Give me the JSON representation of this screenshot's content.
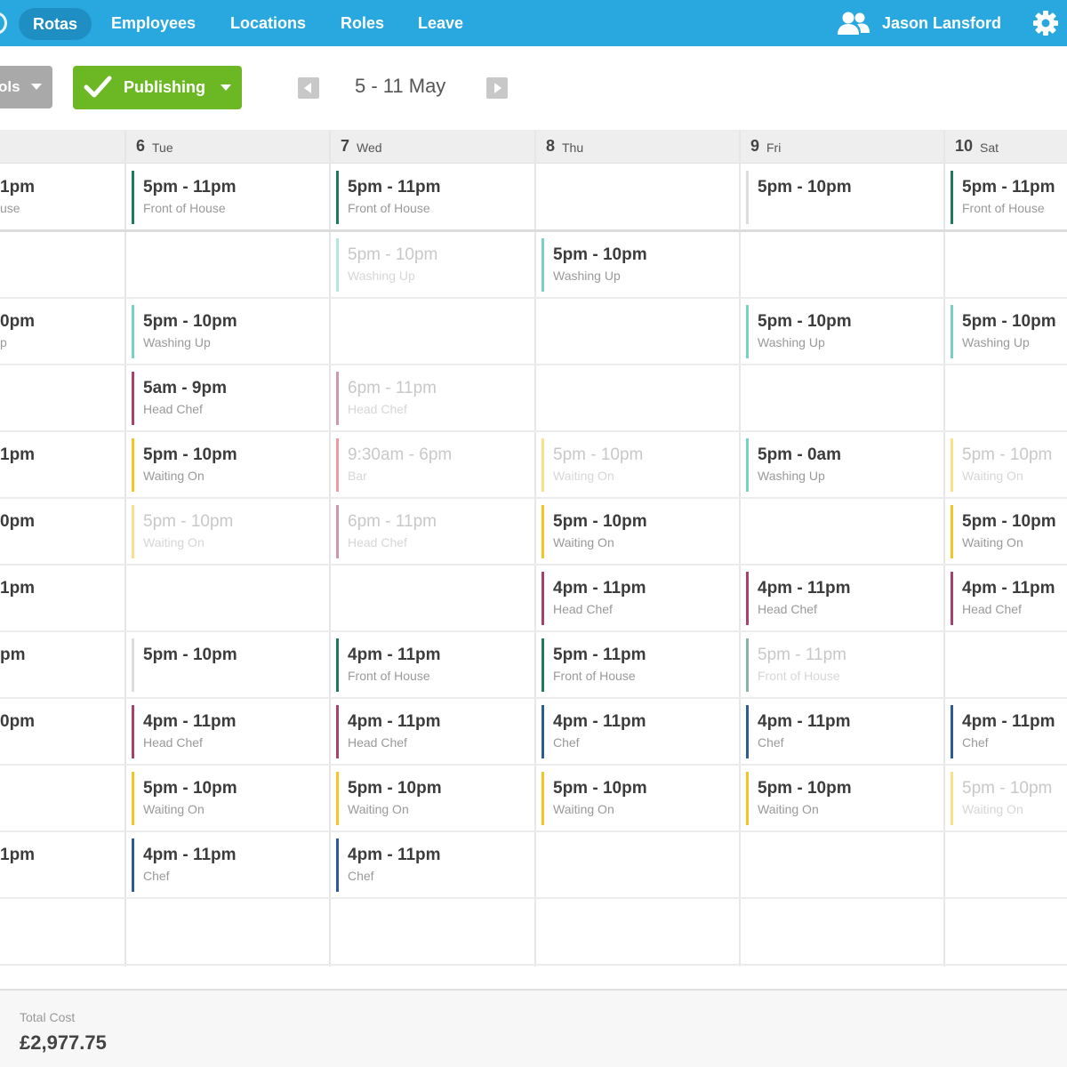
{
  "nav": {
    "items": [
      "Rotas",
      "Employees",
      "Locations",
      "Roles",
      "Leave"
    ],
    "user_name": "Jason Lansford"
  },
  "toolbar": {
    "tools_label": "ols",
    "publish_label": "Publishing",
    "date_range": "5 - 11 May"
  },
  "days": [
    {
      "num": "6",
      "name": "Tue"
    },
    {
      "num": "7",
      "name": "Wed"
    },
    {
      "num": "8",
      "name": "Thu"
    },
    {
      "num": "9",
      "name": "Fri"
    },
    {
      "num": "10",
      "name": "Sat"
    }
  ],
  "colors": {
    "front_of_house": "#1e7a5f",
    "washing_up": "#78d2c3",
    "head_chef": "#a8416b",
    "waiting_on": "#f5c623",
    "bar": "#e3455a",
    "chef": "#2c5c94",
    "unassigned": "#dcdcdc"
  },
  "rows": [
    {
      "partial": {
        "time": "1pm",
        "role": "use"
      },
      "cells": [
        {
          "time": "5pm - 11pm",
          "role": "Front of House",
          "color": "front_of_house"
        },
        {
          "time": "5pm - 11pm",
          "role": "Front of House",
          "color": "front_of_house"
        },
        null,
        {
          "time": "5pm - 10pm",
          "role": "",
          "color": "unassigned"
        },
        {
          "time": "5pm - 11pm",
          "role": "Front of House",
          "color": "front_of_house"
        }
      ]
    },
    {
      "partial": null,
      "cells": [
        null,
        {
          "time": "5pm - 10pm",
          "role": "Washing Up",
          "color": "washing_up",
          "faded": true
        },
        {
          "time": "5pm - 10pm",
          "role": "Washing Up",
          "color": "washing_up"
        },
        null,
        null
      ]
    },
    {
      "partial": {
        "time": "0pm",
        "role": "p"
      },
      "cells": [
        {
          "time": "5pm - 10pm",
          "role": "Washing Up",
          "color": "washing_up"
        },
        null,
        null,
        {
          "time": "5pm - 10pm",
          "role": "Washing Up",
          "color": "washing_up"
        },
        {
          "time": "5pm - 10pm",
          "role": "Washing Up",
          "color": "washing_up"
        }
      ]
    },
    {
      "partial": null,
      "cells": [
        {
          "time": "5am - 9pm",
          "role": "Head Chef",
          "color": "head_chef"
        },
        {
          "time": "6pm - 11pm",
          "role": "Head Chef",
          "color": "head_chef",
          "faded": true
        },
        null,
        null,
        null
      ]
    },
    {
      "partial": {
        "time": "1pm",
        "role": ""
      },
      "cells": [
        {
          "time": "5pm - 10pm",
          "role": "Waiting On",
          "color": "waiting_on"
        },
        {
          "time": "9:30am - 6pm",
          "role": "Bar",
          "color": "bar",
          "faded": true
        },
        {
          "time": "5pm - 10pm",
          "role": "Waiting On",
          "color": "waiting_on",
          "faded": true
        },
        {
          "time": "5pm - 0am",
          "role": "Washing Up",
          "color": "washing_up"
        },
        {
          "time": "5pm - 10pm",
          "role": "Waiting On",
          "color": "waiting_on",
          "faded": true
        }
      ]
    },
    {
      "partial": {
        "time": "0pm",
        "role": ""
      },
      "cells": [
        {
          "time": "5pm - 10pm",
          "role": "Waiting On",
          "color": "waiting_on",
          "faded": true
        },
        {
          "time": "6pm - 11pm",
          "role": "Head Chef",
          "color": "head_chef",
          "faded": true
        },
        {
          "time": "5pm - 10pm",
          "role": "Waiting On",
          "color": "waiting_on"
        },
        null,
        {
          "time": "5pm - 10pm",
          "role": "Waiting On",
          "color": "waiting_on"
        }
      ]
    },
    {
      "partial": {
        "time": "1pm",
        "role": ""
      },
      "cells": [
        null,
        null,
        {
          "time": "4pm - 11pm",
          "role": "Head Chef",
          "color": "head_chef"
        },
        {
          "time": "4pm - 11pm",
          "role": "Head Chef",
          "color": "head_chef"
        },
        {
          "time": "4pm - 11pm",
          "role": "Head Chef",
          "color": "head_chef"
        }
      ]
    },
    {
      "partial": {
        "time": "pm",
        "role": ""
      },
      "cells": [
        {
          "time": "5pm - 10pm",
          "role": "",
          "color": "unassigned"
        },
        {
          "time": "4pm - 11pm",
          "role": "Front of House",
          "color": "front_of_house"
        },
        {
          "time": "5pm - 11pm",
          "role": "Front of House",
          "color": "front_of_house"
        },
        {
          "time": "5pm - 11pm",
          "role": "Front of House",
          "color": "front_of_house",
          "faded": true
        },
        null
      ]
    },
    {
      "partial": {
        "time": "0pm",
        "role": ""
      },
      "cells": [
        {
          "time": "4pm - 11pm",
          "role": "Head Chef",
          "color": "head_chef"
        },
        {
          "time": "4pm - 11pm",
          "role": "Head Chef",
          "color": "head_chef"
        },
        {
          "time": "4pm - 11pm",
          "role": "Chef",
          "color": "chef"
        },
        {
          "time": "4pm - 11pm",
          "role": "Chef",
          "color": "chef"
        },
        {
          "time": "4pm - 11pm",
          "role": "Chef",
          "color": "chef"
        }
      ]
    },
    {
      "partial": null,
      "cells": [
        {
          "time": "5pm - 10pm",
          "role": "Waiting On",
          "color": "waiting_on"
        },
        {
          "time": "5pm - 10pm",
          "role": "Waiting On",
          "color": "waiting_on"
        },
        {
          "time": "5pm - 10pm",
          "role": "Waiting On",
          "color": "waiting_on"
        },
        {
          "time": "5pm - 10pm",
          "role": "Waiting On",
          "color": "waiting_on"
        },
        {
          "time": "5pm - 10pm",
          "role": "Waiting On",
          "color": "waiting_on",
          "faded": true
        }
      ]
    },
    {
      "partial": {
        "time": "1pm",
        "role": ""
      },
      "cells": [
        {
          "time": "4pm - 11pm",
          "role": "Chef",
          "color": "chef"
        },
        {
          "time": "4pm - 11pm",
          "role": "Chef",
          "color": "chef"
        },
        null,
        null,
        null
      ]
    }
  ],
  "footer": {
    "total_cost_label": "Total Cost",
    "total_cost_value": "£2,977.75"
  }
}
